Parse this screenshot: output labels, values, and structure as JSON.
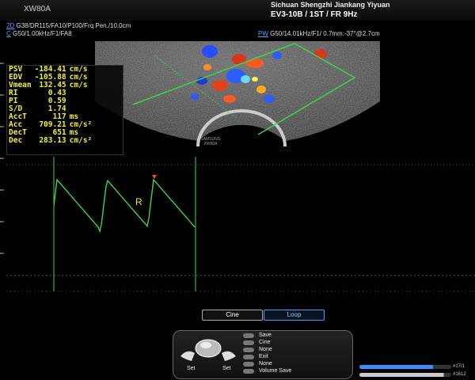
{
  "header": {
    "model": "XW80A",
    "hospital": "Sichuan Shengzhi Jiankang Yiyuan",
    "probe_info": "EV3-10B / 1ST / FR 9Hz"
  },
  "params": {
    "mode_2d": "2D",
    "line_2d": "G38/DR115/FA10/P100/Frq Pen./10.0cm",
    "mode_c": "C",
    "line_c": "G50/1.00kHz/F1/FA8",
    "mode_pw": "PW",
    "line_pw": "G50/14.01kHz/F1/ 0.7mm:-37°@2.7cm"
  },
  "measurements": [
    {
      "name": "PSV",
      "value": "-184.41",
      "unit": "cm/s"
    },
    {
      "name": "EDV",
      "value": "-105.88",
      "unit": "cm/s"
    },
    {
      "name": "Vmean",
      "value": "132.45",
      "unit": "cm/s"
    },
    {
      "name": "RI",
      "value": "0.43",
      "unit": ""
    },
    {
      "name": "PI",
      "value": "0.59",
      "unit": ""
    },
    {
      "name": "S/D",
      "value": "1.74",
      "unit": ""
    },
    {
      "name": "AccT",
      "value": "117",
      "unit": "ms"
    },
    {
      "name": "Acc",
      "value": "709.21",
      "unit": "cm/s²"
    },
    {
      "name": "DecT",
      "value": "651",
      "unit": "ms"
    },
    {
      "name": "Dec",
      "value": "283.13",
      "unit": "cm/s²"
    }
  ],
  "image_labels": {
    "watermark": "SAMSUNG XW80A",
    "marker_r": "R"
  },
  "controls": {
    "cine_label": "Cine",
    "loop_label": "Loop",
    "set_left": "Set",
    "set_right": "Set",
    "menu": [
      "Save",
      "Cine",
      "None",
      "Exit",
      "None",
      "Volume Save"
    ]
  },
  "sliders": {
    "top_frames": "#17/1",
    "top_fraction": 0.8,
    "bottom_frames": "#1612",
    "bottom_fraction": 0.92
  },
  "colors": {
    "measure_text": "#f3ee3a",
    "trace": "#3fd44a",
    "accent": "#4aa3ff"
  }
}
